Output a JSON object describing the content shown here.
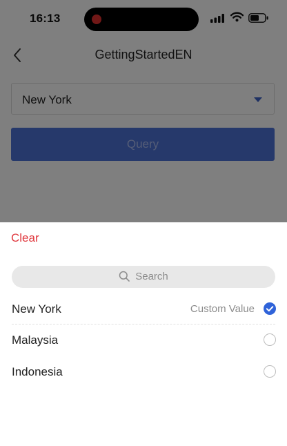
{
  "status_bar": {
    "time": "16:13"
  },
  "nav": {
    "title": "GettingStartedEN"
  },
  "form": {
    "selected_city": "New York",
    "query_label": "Query"
  },
  "sheet": {
    "clear_label": "Clear",
    "search_placeholder": "Search",
    "options": [
      {
        "label": "New York",
        "note": "Custom Value",
        "checked": true
      },
      {
        "label": "Malaysia",
        "note": "",
        "checked": false
      },
      {
        "label": "Indonesia",
        "note": "",
        "checked": false
      }
    ]
  },
  "colors": {
    "accent": "#2f63d9",
    "clear": "#e0383e",
    "button": "#4d72d6"
  },
  "icons": [
    "back-chevron-icon",
    "caret-down-icon",
    "search-icon",
    "check-icon",
    "recording-dot-icon",
    "signal-icon",
    "wifi-icon",
    "battery-icon"
  ]
}
